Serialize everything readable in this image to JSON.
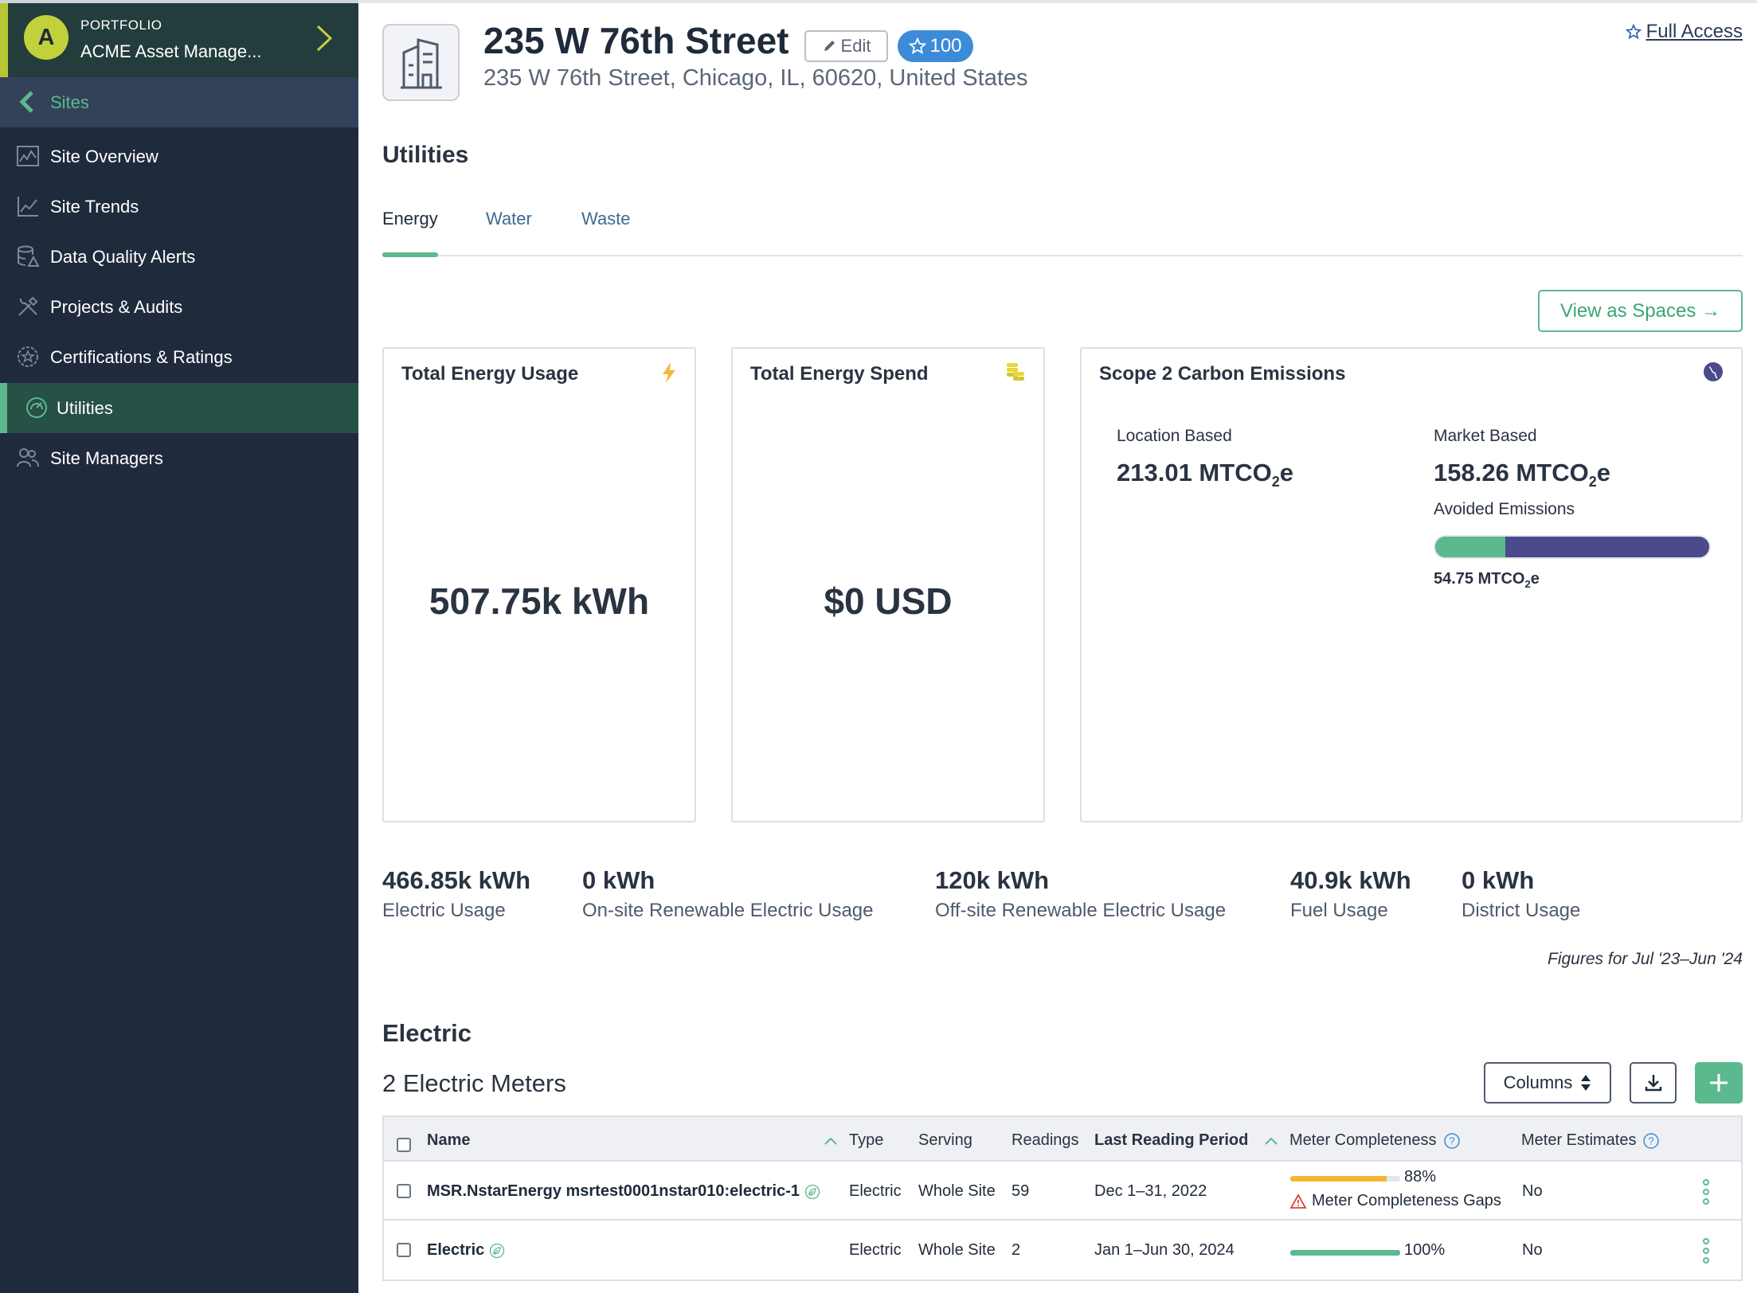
{
  "sidebar": {
    "portfolio_label": "PORTFOLIO",
    "portfolio_name": "ACME Asset Manage...",
    "avatar_letter": "A",
    "back_label": "Sites",
    "items": [
      {
        "label": "Site Overview",
        "icon": "chart-icon"
      },
      {
        "label": "Site Trends",
        "icon": "trend-icon"
      },
      {
        "label": "Data Quality Alerts",
        "icon": "database-alert-icon"
      },
      {
        "label": "Projects & Audits",
        "icon": "tools-icon"
      },
      {
        "label": "Certifications & Ratings",
        "icon": "badge-icon"
      },
      {
        "label": "Utilities",
        "icon": "gauge-icon",
        "active": true
      },
      {
        "label": "Site Managers",
        "icon": "users-icon"
      }
    ]
  },
  "header": {
    "title": "235 W 76th Street",
    "edit_label": "Edit",
    "score": "100",
    "address": "235 W 76th Street, Chicago, IL, 60620, United States",
    "access_label": "Full Access"
  },
  "utilities": {
    "title": "Utilities",
    "tabs": [
      "Energy",
      "Water",
      "Waste"
    ],
    "active_tab": "Energy",
    "view_spaces_label": "View as Spaces →"
  },
  "cards": {
    "usage": {
      "title": "Total Energy Usage",
      "value": "507.75k kWh"
    },
    "spend": {
      "title": "Total Energy Spend",
      "value": "$0 USD"
    },
    "emissions": {
      "title": "Scope 2 Carbon Emissions",
      "location_label": "Location Based",
      "location_value": "213.01 MTCO",
      "market_label": "Market Based",
      "market_value": "158.26 MTCO",
      "unit_sub": "2",
      "unit_suffix": "e",
      "avoided_label": "Avoided Emissions",
      "avoided_value": "54.75 MTCO",
      "avoided_fraction": 0.257
    }
  },
  "stats": [
    {
      "value": "466.85k kWh",
      "label": "Electric Usage"
    },
    {
      "value": "0 kWh",
      "label": "On-site Renewable Electric Usage"
    },
    {
      "value": "120k kWh",
      "label": "Off-site Renewable Electric Usage"
    },
    {
      "value": "40.9k kWh",
      "label": "Fuel Usage"
    },
    {
      "value": "0 kWh",
      "label": "District Usage"
    }
  ],
  "figures_note": "Figures for Jul '23–Jun '24",
  "electric": {
    "title": "Electric",
    "meters_count": "2 Electric Meters",
    "columns_label": "Columns",
    "table": {
      "headers": {
        "name": "Name",
        "type": "Type",
        "serving": "Serving",
        "readings": "Readings",
        "last_period": "Last Reading Period",
        "completeness": "Meter Completeness",
        "estimates": "Meter Estimates"
      },
      "rows": [
        {
          "name": "MSR.NstarEnergy msrtest0001nstar010:electric-1",
          "type": "Electric",
          "serving": "Whole Site",
          "readings": "59",
          "period": "Dec 1–31, 2022",
          "completeness": "88%",
          "completeness_fraction": 0.88,
          "completeness_color": "#f5b638",
          "gap_label": "Meter Completeness Gaps",
          "estimates": "No"
        },
        {
          "name": "Electric",
          "type": "Electric",
          "serving": "Whole Site",
          "readings": "2",
          "period": "Jan 1–Jun 30, 2024",
          "completeness": "100%",
          "completeness_fraction": 1.0,
          "completeness_color": "#5cb98e",
          "estimates": "No"
        }
      ]
    }
  },
  "colors": {
    "sidebar_bg": "#202a3d",
    "accent_green": "#5cb98e",
    "badge_blue": "#3b8bd8",
    "emission_bar": "#4a4a8c",
    "avatar": "#c2d03b"
  }
}
